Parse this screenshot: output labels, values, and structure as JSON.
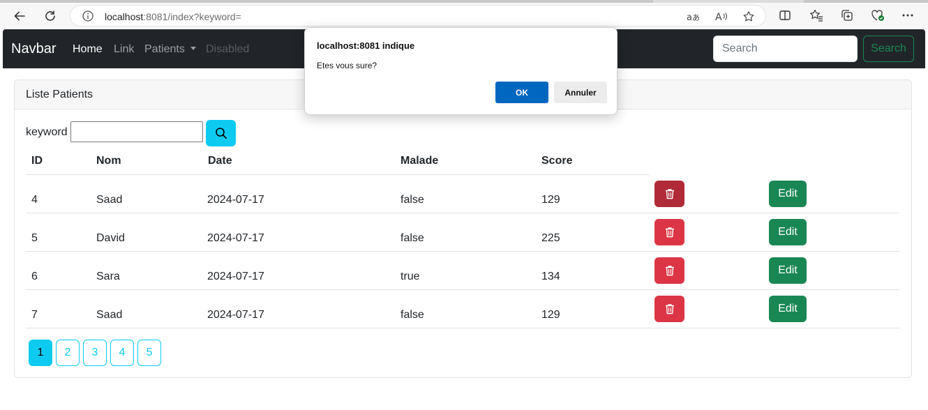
{
  "browser": {
    "url_host": "localhost",
    "url_rest": ":8081/index?keyword=",
    "read_aloud_icon": "read-aloud-icon",
    "translate_icon": "translate-icon"
  },
  "navbar": {
    "brand": "Navbar",
    "links": [
      "Home",
      "Link",
      "Patients",
      "Disabled"
    ],
    "search_placeholder": "Search",
    "search_button": "Search"
  },
  "card": {
    "header": "Liste Patients",
    "keyword_label": "keyword"
  },
  "table": {
    "columns": [
      "ID",
      "Nom",
      "Date",
      "Malade",
      "Score"
    ],
    "rows": [
      {
        "id": "4",
        "nom": "Saad",
        "date": "2024-07-17",
        "malade": "false",
        "score": "129"
      },
      {
        "id": "5",
        "nom": "David",
        "date": "2024-07-17",
        "malade": "false",
        "score": "225"
      },
      {
        "id": "6",
        "nom": "Sara",
        "date": "2024-07-17",
        "malade": "true",
        "score": "134"
      },
      {
        "id": "7",
        "nom": "Saad",
        "date": "2024-07-17",
        "malade": "false",
        "score": "129"
      }
    ],
    "edit_label": "Edit"
  },
  "pagination": [
    "1",
    "2",
    "3",
    "4",
    "5"
  ],
  "dialog": {
    "title": "localhost:8081 indique",
    "message": "Etes vous sure?",
    "ok": "OK",
    "cancel": "Annuler"
  },
  "colors": {
    "navbar": "#212529",
    "info": "#0dcaf0",
    "danger": "#dc3545",
    "success": "#198754",
    "dialog_ok": "#0067c0"
  }
}
